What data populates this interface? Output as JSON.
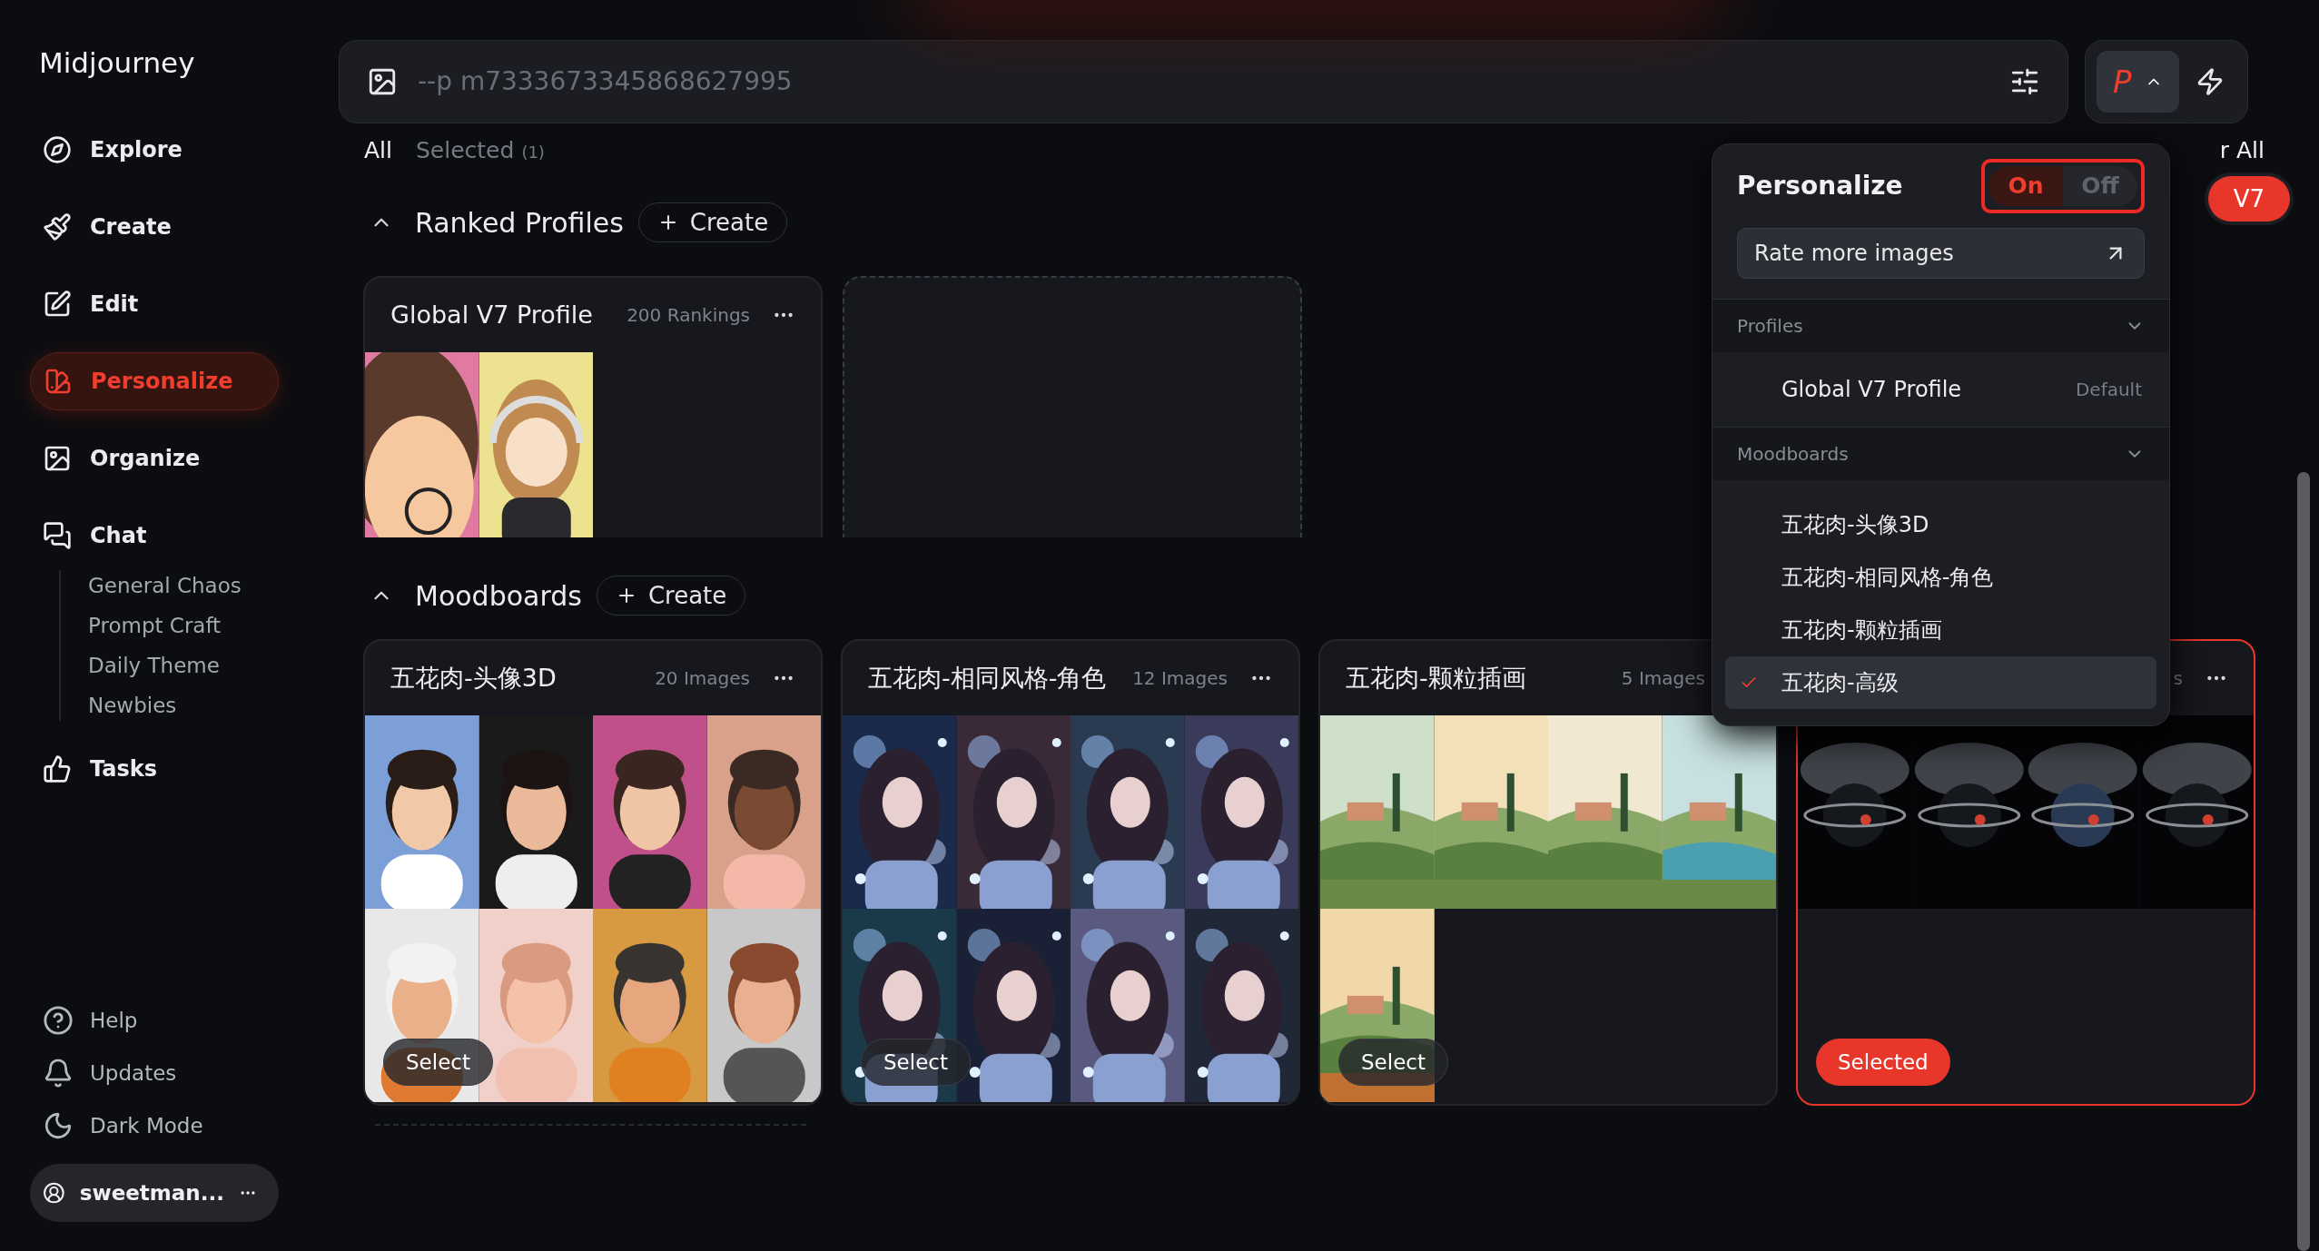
{
  "app": {
    "title": "Midjourney"
  },
  "nav": [
    {
      "label": "Explore",
      "selected": false
    },
    {
      "label": "Create",
      "selected": false
    },
    {
      "label": "Edit",
      "selected": false
    },
    {
      "label": "Personalize",
      "selected": true
    },
    {
      "label": "Organize",
      "selected": false
    },
    {
      "label": "Chat",
      "selected": false,
      "children": [
        {
          "label": "General Chaos"
        },
        {
          "label": "Prompt Craft"
        },
        {
          "label": "Daily Theme"
        },
        {
          "label": "Newbies"
        }
      ]
    },
    {
      "label": "Tasks",
      "selected": false
    }
  ],
  "footer_nav": [
    {
      "label": "Help"
    },
    {
      "label": "Updates"
    },
    {
      "label": "Dark Mode"
    }
  ],
  "user": {
    "name": "sweetman..."
  },
  "prompt": {
    "value": "--p m7333673345868627995"
  },
  "personalize_button": {
    "label": "P",
    "expanded": true
  },
  "filter_tabs": [
    {
      "label": "All",
      "selected": true
    },
    {
      "label": "Selected",
      "count": "(1)",
      "selected": false
    }
  ],
  "clear_all": "r All",
  "version_button": "V7",
  "ranked_profiles": {
    "title": "Ranked Profiles",
    "expanded": true,
    "create": "Create",
    "cards": [
      {
        "title": "Global V7 Profile",
        "count": "200 Rankings",
        "menu": true
      }
    ]
  },
  "moodboards": {
    "title": "Moodboards",
    "expanded": true,
    "create": "Create",
    "cards": [
      {
        "title": "五花肉-头像3D",
        "count": "20 Images",
        "menu": true,
        "selected": false,
        "action": "Select"
      },
      {
        "title": "五花肉-相同风格-角色",
        "count": "12 Images",
        "menu": true,
        "selected": false,
        "action": "Select"
      },
      {
        "title": "五花肉-颗粒插画",
        "count": "5 Images",
        "menu": false,
        "selected": false,
        "action": "Select"
      },
      {
        "count": "s",
        "menu": true,
        "selected": true,
        "action": "Selected"
      }
    ]
  },
  "dropdown": {
    "title": "Personalize",
    "toggle": {
      "highlighted": true,
      "options": [
        {
          "label": "On",
          "selected": true
        },
        {
          "label": "Off",
          "selected": false
        }
      ]
    },
    "rate_button": "Rate more images",
    "sections": [
      {
        "title": "Profiles",
        "expanded": true,
        "items": [
          {
            "label": "Global V7 Profile",
            "note": "Default",
            "checked": false
          }
        ]
      },
      {
        "title": "Moodboards",
        "expanded": true,
        "items": [
          {
            "label": "五花肉-头像3D",
            "checked": false
          },
          {
            "label": "五花肉-相同风格-角色",
            "checked": false
          },
          {
            "label": "五花肉-颗粒插画",
            "checked": false
          },
          {
            "label": "五花肉-高级",
            "checked": true
          }
        ]
      }
    ]
  }
}
